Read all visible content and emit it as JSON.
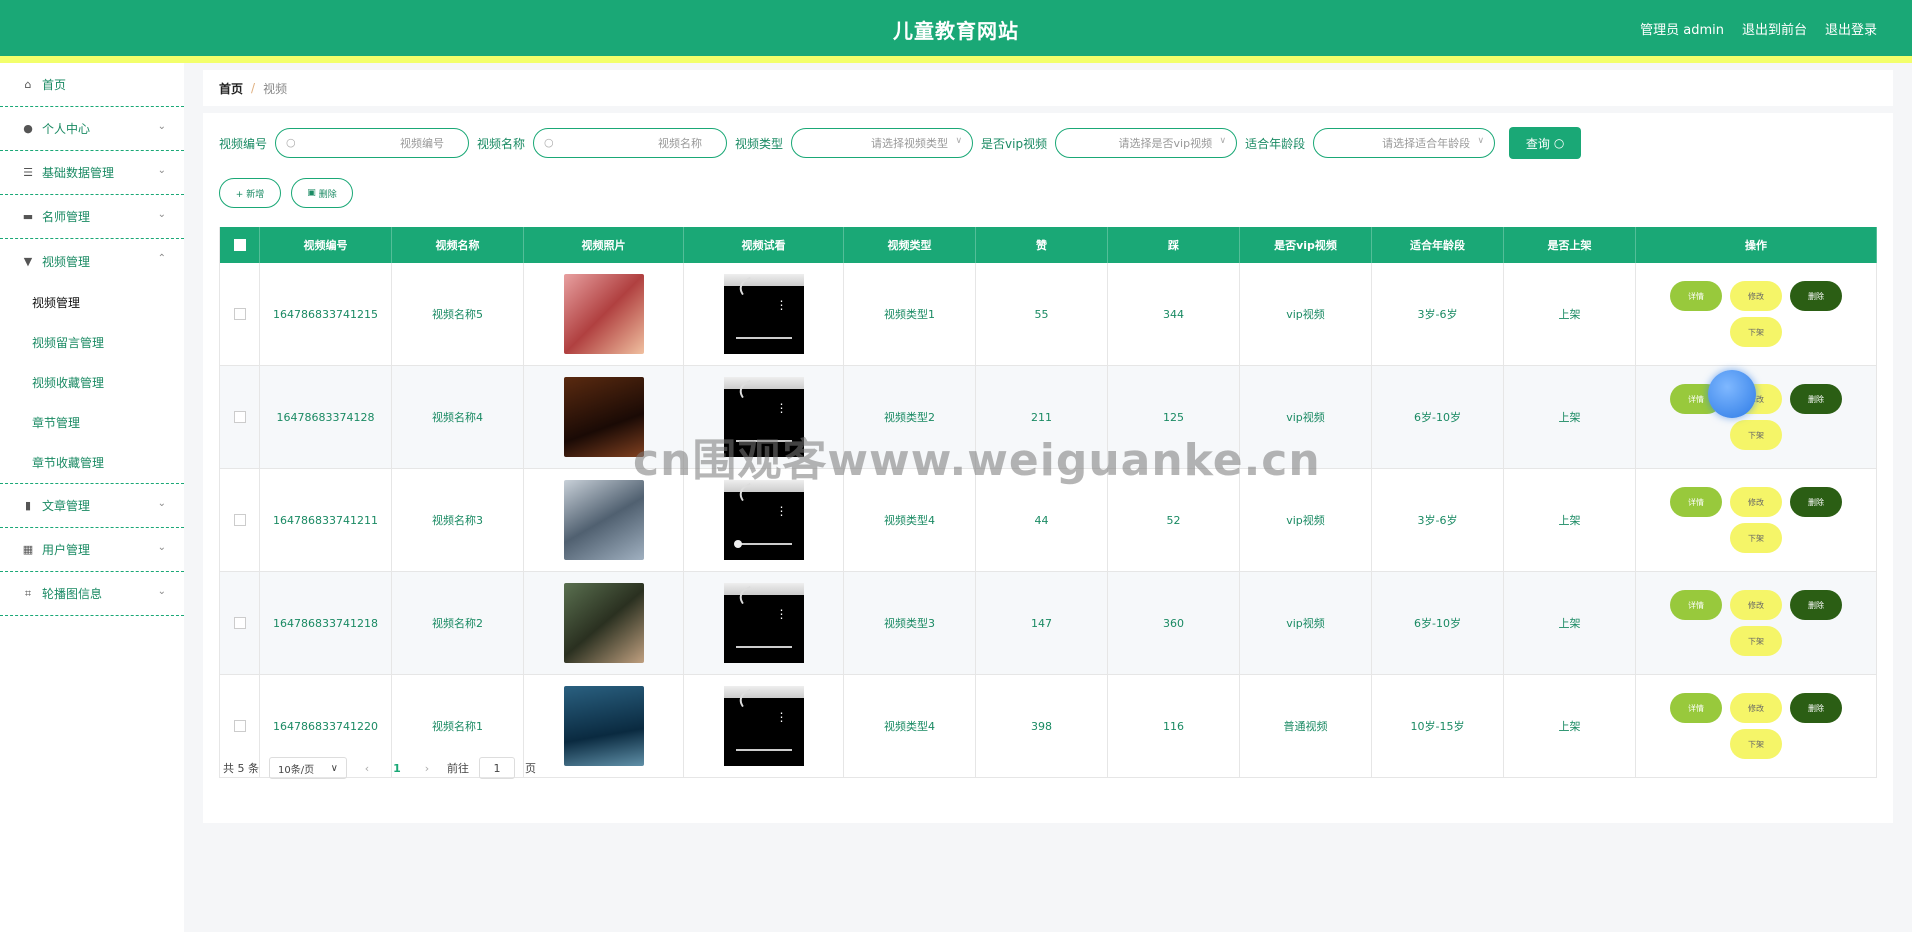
{
  "header": {
    "title": "儿童教育网站",
    "admin_label": "管理员 admin",
    "front_label": "退出到前台",
    "logout_label": "退出登录"
  },
  "sidebar": {
    "items": [
      {
        "label": "首页",
        "icon": "home-icon",
        "chevron": ""
      },
      {
        "label": "个人中心",
        "icon": "user-icon",
        "chevron": "⌄"
      },
      {
        "label": "基础数据管理",
        "icon": "list-icon",
        "chevron": "⌄"
      },
      {
        "label": "名师管理",
        "icon": "chat-icon",
        "chevron": "⌄"
      },
      {
        "label": "视频管理",
        "icon": "video-icon",
        "chevron": "⌃"
      }
    ],
    "sub_items": [
      "视频管理",
      "视频留言管理",
      "视频收藏管理",
      "章节管理",
      "章节收藏管理"
    ],
    "items_after": [
      {
        "label": "文章管理",
        "icon": "chart-icon",
        "chevron": "⌄"
      },
      {
        "label": "用户管理",
        "icon": "grid-icon",
        "chevron": "⌄"
      },
      {
        "label": "轮播图信息",
        "icon": "crop-icon",
        "chevron": "⌄"
      }
    ]
  },
  "breadcrumb": {
    "home": "首页",
    "sep": "/",
    "current": "视频"
  },
  "filters": {
    "code_label": "视频编号",
    "code_placeholder": "视频编号",
    "name_label": "视频名称",
    "name_placeholder": "视频名称",
    "type_label": "视频类型",
    "type_placeholder": "请选择视频类型",
    "vip_label": "是否vip视频",
    "vip_placeholder": "请选择是否vip视频",
    "age_label": "适合年龄段",
    "age_placeholder": "请选择适合年龄段",
    "query_label": "查询"
  },
  "actions": {
    "add_label": "+ 新增",
    "delete_label": "删除"
  },
  "table": {
    "columns": [
      "视频编号",
      "视频名称",
      "视频照片",
      "视频试看",
      "视频类型",
      "赞",
      "踩",
      "是否vip视频",
      "适合年龄段",
      "是否上架",
      "操作"
    ],
    "rows": [
      {
        "code": "164786833741215",
        "name": "视频名称5",
        "type": "视频类型1",
        "like": "55",
        "dislike": "344",
        "vip": "vip视频",
        "age": "3岁-6岁",
        "status": "上架"
      },
      {
        "code": "16478683374128",
        "name": "视频名称4",
        "type": "视频类型2",
        "like": "211",
        "dislike": "125",
        "vip": "vip视频",
        "age": "6岁-10岁",
        "status": "上架"
      },
      {
        "code": "164786833741211",
        "name": "视频名称3",
        "type": "视频类型4",
        "like": "44",
        "dislike": "52",
        "vip": "vip视频",
        "age": "3岁-6岁",
        "status": "上架"
      },
      {
        "code": "164786833741218",
        "name": "视频名称2",
        "type": "视频类型3",
        "like": "147",
        "dislike": "360",
        "vip": "vip视频",
        "age": "6岁-10岁",
        "status": "上架"
      },
      {
        "code": "164786833741220",
        "name": "视频名称1",
        "type": "视频类型4",
        "like": "398",
        "dislike": "116",
        "vip": "普通视频",
        "age": "10岁-15岁",
        "status": "上架"
      }
    ],
    "op_detail": "详情",
    "op_edit": "修改",
    "op_delete": "删除",
    "op_down": "下架"
  },
  "pagination": {
    "total": "共 5 条",
    "page_size": "10条/页",
    "current_page": "1",
    "goto": "前往",
    "goto_value": "1",
    "page_unit": "页"
  },
  "watermark": "cn围观客www.weiguanke.cn",
  "colors": {
    "primary": "#1aa876",
    "accent_bar": "#f3ff6b",
    "detail": "#98c93c",
    "edit": "#f5f568",
    "delete": "#2b5e14"
  }
}
